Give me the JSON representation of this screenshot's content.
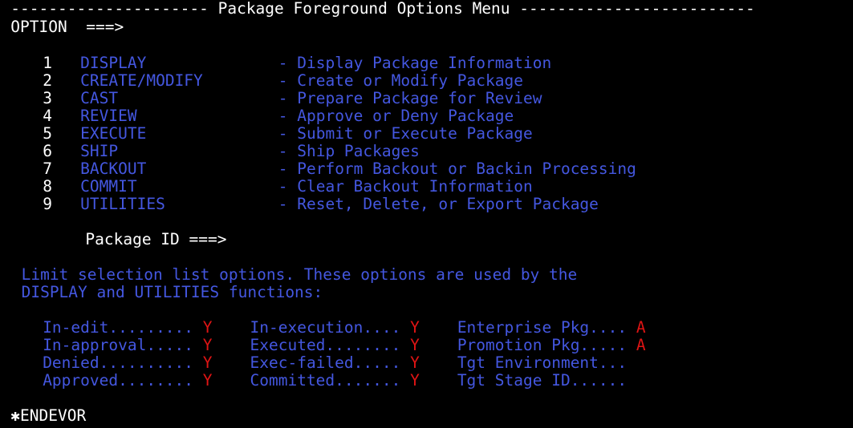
{
  "terminal": {
    "title": "Package Foreground Options Menu",
    "header_dash_left": "---------------------",
    "header_dash_right": "-------------------------",
    "option_prompt_label": "OPTION",
    "option_prompt_arrow": "===>",
    "option_input_value": "",
    "package_id_label": "Package ID ===>",
    "package_id_value": "",
    "product_tag": "✱ENDEVOR"
  },
  "menu": {
    "items": [
      {
        "number": "1",
        "label": "DISPLAY",
        "dash": "-",
        "description": "Display Package Information"
      },
      {
        "number": "2",
        "label": "CREATE/MODIFY",
        "dash": "-",
        "description": "Create or Modify Package"
      },
      {
        "number": "3",
        "label": "CAST",
        "dash": "-",
        "description": "Prepare Package for Review"
      },
      {
        "number": "4",
        "label": "REVIEW",
        "dash": "-",
        "description": "Approve or Deny Package"
      },
      {
        "number": "5",
        "label": "EXECUTE",
        "dash": "-",
        "description": "Submit or Execute Package"
      },
      {
        "number": "6",
        "label": "SHIP",
        "dash": "-",
        "description": "Ship Packages"
      },
      {
        "number": "7",
        "label": "BACKOUT",
        "dash": "-",
        "description": "Perform Backout or Backin Processing"
      },
      {
        "number": "8",
        "label": "COMMIT",
        "dash": "-",
        "description": "Clear Backout Information"
      },
      {
        "number": "9",
        "label": "UTILITIES",
        "dash": "-",
        "description": "Reset, Delete, or Export Package"
      }
    ]
  },
  "instructions": {
    "line1": "Limit selection list options. These options are used by the",
    "line2": "DISPLAY and UTILITIES functions:"
  },
  "filters": {
    "column1": [
      {
        "label": "In-edit.........",
        "value": "Y"
      },
      {
        "label": "In-approval.....",
        "value": "Y"
      },
      {
        "label": "Denied..........",
        "value": "Y"
      },
      {
        "label": "Approved........",
        "value": "Y"
      }
    ],
    "column2": [
      {
        "label": "In-execution....",
        "value": "Y"
      },
      {
        "label": "Executed........",
        "value": "Y"
      },
      {
        "label": "Exec-failed.....",
        "value": "Y"
      },
      {
        "label": "Committed.......",
        "value": "Y"
      }
    ],
    "column3": [
      {
        "label": "Enterprise Pkg....",
        "value": "A"
      },
      {
        "label": "Promotion Pkg.....",
        "value": "A"
      },
      {
        "label": "Tgt Environment...",
        "value": ""
      },
      {
        "label": "Tgt Stage ID......",
        "value": ""
      }
    ]
  },
  "colors": {
    "background": "#000000",
    "neutral": "#ffffff",
    "protected": "#4457e0",
    "value": "#e01414"
  }
}
